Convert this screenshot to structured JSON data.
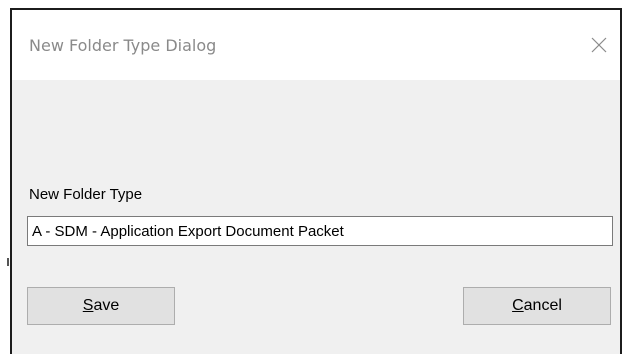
{
  "window": {
    "title": "New Folder Type Dialog",
    "close_icon": "close-icon"
  },
  "form": {
    "label": "New Folder Type",
    "value": "A - SDM - Application Export Document Packet"
  },
  "buttons": {
    "save_key": "S",
    "save_rest": "ave",
    "cancel_key": "C",
    "cancel_rest": "ancel"
  }
}
